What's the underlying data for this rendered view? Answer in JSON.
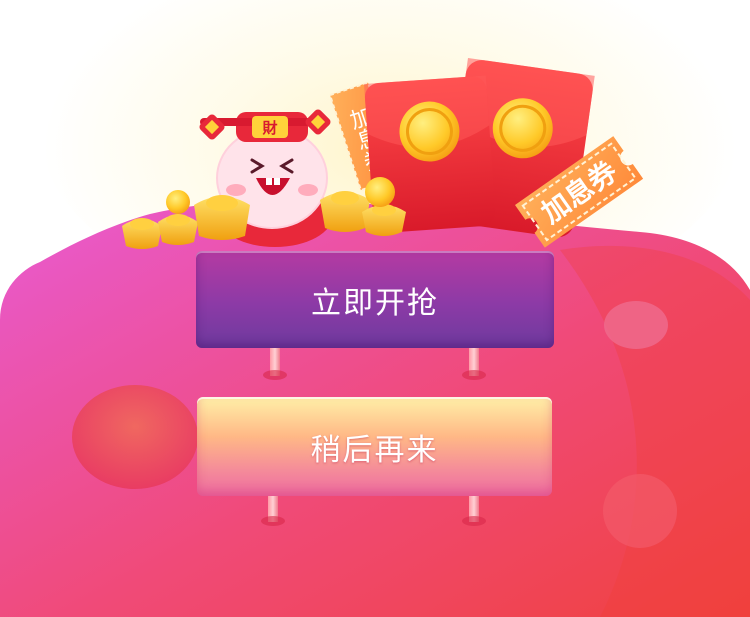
{
  "buttons": {
    "grab_now": "立即开抢",
    "try_later": "稍后再来"
  },
  "coupons": {
    "large_label": "加息券",
    "small_label": "加息券"
  },
  "mascot": {
    "hat_character": "財"
  },
  "colors": {
    "hill_light": "#e85bd4",
    "hill_dark": "#f0413e",
    "grab_button": "#8c3aa6",
    "later_button_top": "#fff0a8",
    "later_button_bottom": "#ee6ba0",
    "envelope": "#e8282f",
    "coin": "#ffc928"
  }
}
